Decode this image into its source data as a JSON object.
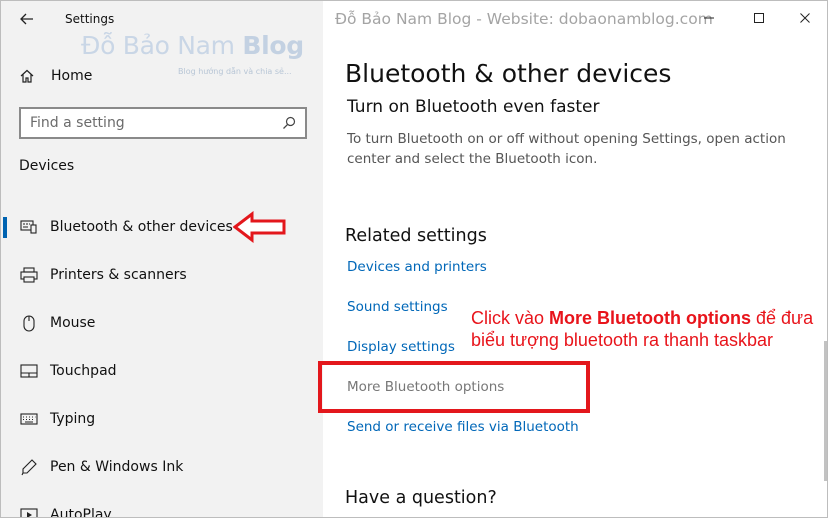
{
  "window": {
    "app_title": "Settings",
    "caption": "Đỗ Bảo Nam Blog - Website: dobaonamblog.com"
  },
  "watermark": {
    "logo_regular": "Đỗ Bảo Nam ",
    "logo_bold": "Blog",
    "tagline": "Blog hướng dẫn và chia sẻ..."
  },
  "sidebar": {
    "home_label": "Home",
    "search_placeholder": "Find a setting",
    "section_title": "Devices",
    "items": [
      {
        "label": "Bluetooth & other devices",
        "icon": "bluetooth-devices-icon",
        "active": true
      },
      {
        "label": "Printers & scanners",
        "icon": "printer-icon"
      },
      {
        "label": "Mouse",
        "icon": "mouse-icon"
      },
      {
        "label": "Touchpad",
        "icon": "touchpad-icon"
      },
      {
        "label": "Typing",
        "icon": "keyboard-icon"
      },
      {
        "label": "Pen & Windows Ink",
        "icon": "pen-icon"
      },
      {
        "label": "AutoPlay",
        "icon": "autoplay-icon"
      }
    ]
  },
  "main": {
    "page_title": "Bluetooth & other devices",
    "subtitle": "Turn on Bluetooth even faster",
    "description": "To turn Bluetooth on or off without opening Settings, open action center and select the Bluetooth icon.",
    "related_title": "Related settings",
    "related_links": [
      {
        "label": "Devices and printers"
      },
      {
        "label": "Sound settings"
      },
      {
        "label": "Display settings"
      },
      {
        "label": "More Bluetooth options",
        "highlighted": true
      },
      {
        "label": "Send or receive files via Bluetooth"
      }
    ],
    "question_title": "Have a question?"
  },
  "annotation": {
    "prefix": "Click vào ",
    "bold": "More Bluetooth options",
    "suffix": " để đưa biểu tượng bluetooth ra thanh taskbar"
  },
  "colors": {
    "accent": "#0063b1",
    "link": "#0067b8",
    "annotation_red": "#e3171c",
    "sidebar_bg": "#f2f2f2"
  }
}
